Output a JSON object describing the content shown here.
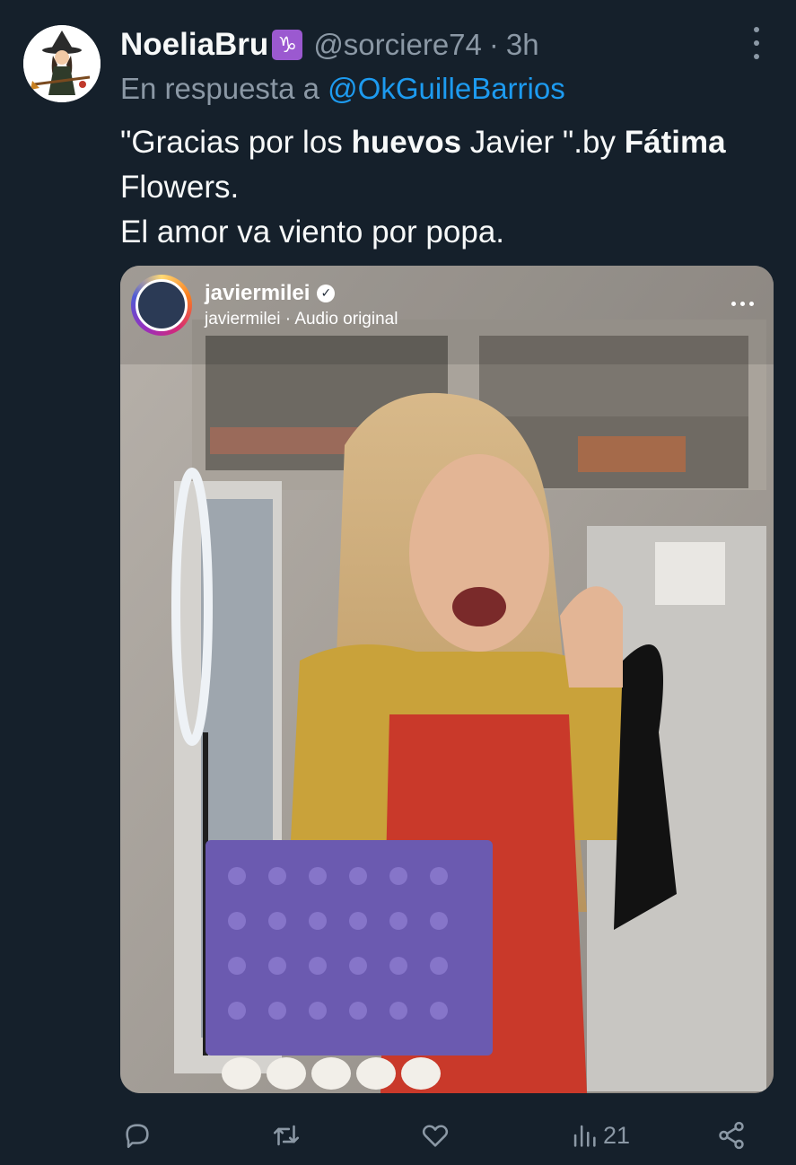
{
  "tweet": {
    "display_name": "NoeliaBru",
    "zodiac_badge": "♑",
    "handle": "@sorciere74",
    "separator": "·",
    "time": "3h",
    "reply_prefix": "En respuesta a",
    "reply_mention": "@OkGuilleBarrios",
    "text": {
      "part1": "\"Gracias por los ",
      "bold1": "huevos",
      "part2": " Javier \".by ",
      "bold2": "Fátima",
      "line2": "Flowers.",
      "line3": "El amor va viento por popa."
    }
  },
  "media": {
    "username": "javiermilei",
    "subtitle_user": "javiermilei",
    "subtitle_separator": "·",
    "subtitle_audio": "Audio original"
  },
  "actions": {
    "reply_icon": "reply-icon",
    "retweet_icon": "retweet-icon",
    "like_icon": "heart-icon",
    "views_icon": "views-icon",
    "views_count": "21",
    "share_icon": "share-icon"
  },
  "colors": {
    "background": "#15202b",
    "secondary_text": "#8b98a5",
    "mention": "#1d9bf0",
    "zodiac_badge": "#9b59d0"
  }
}
